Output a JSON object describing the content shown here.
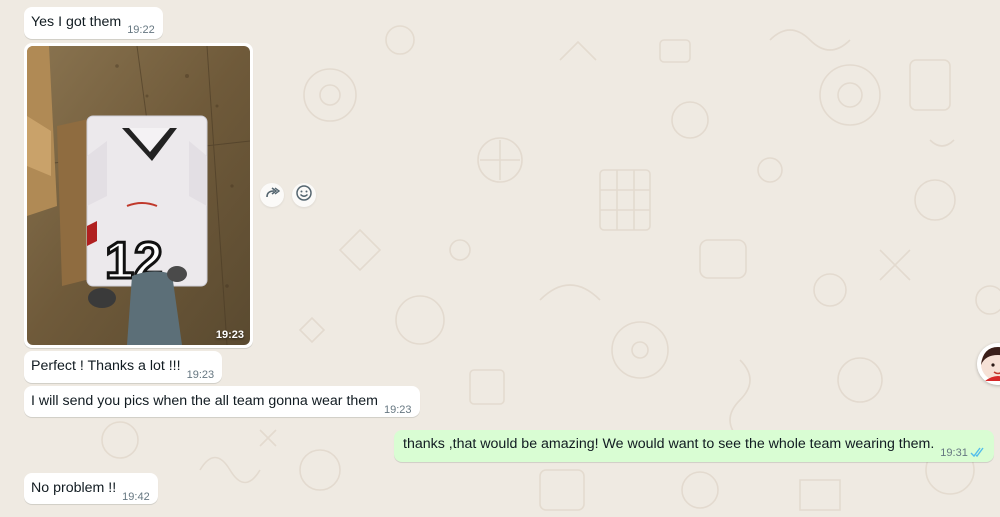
{
  "chat": {
    "background_color": "#efeae2",
    "messages": [
      {
        "type": "incoming",
        "text": "Yes I got them",
        "time": "19:22"
      },
      {
        "type": "incoming-image",
        "time": "19:23",
        "image_description": "photo of a white football jersey number 12 in a plastic bag on a tiled floor"
      },
      {
        "type": "incoming",
        "text": "Perfect ! Thanks a lot !!!",
        "time": "19:23"
      },
      {
        "type": "incoming",
        "text": "I will send you pics when the all team gonna wear them",
        "time": "19:23"
      },
      {
        "type": "outgoing",
        "text": "thanks ,that would be amazing! We would want to see the whole team wearing them.",
        "time": "19:31",
        "status": "read"
      },
      {
        "type": "incoming",
        "text": "No problem !!",
        "time": "19:42"
      }
    ]
  },
  "actions": {
    "forward_icon": "forward-icon",
    "react_icon": "emoji-react-icon"
  },
  "colors": {
    "incoming_bubble": "#ffffff",
    "outgoing_bubble": "#d9fdd3",
    "read_ticks": "#53bdeb",
    "timestamp": "#667781"
  }
}
